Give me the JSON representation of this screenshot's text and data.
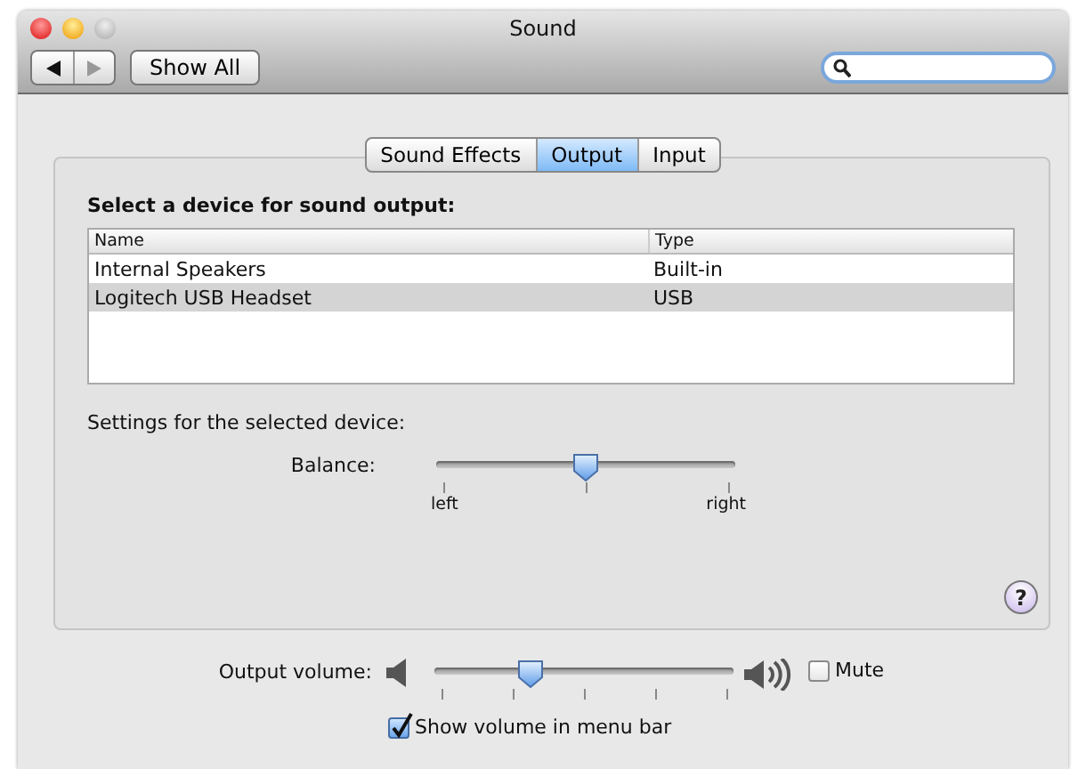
{
  "window": {
    "title": "Sound"
  },
  "toolbar": {
    "show_all": "Show All"
  },
  "tabs": [
    {
      "label": "Sound Effects",
      "selected": false
    },
    {
      "label": "Output",
      "selected": true
    },
    {
      "label": "Input",
      "selected": false
    }
  ],
  "devices": {
    "heading": "Select a device for sound output:",
    "columns": [
      "Name",
      "Type"
    ],
    "rows": [
      {
        "name": "Internal Speakers",
        "type": "Built-in",
        "selected": false
      },
      {
        "name": "Logitech USB Headset",
        "type": "USB",
        "selected": true
      }
    ]
  },
  "settings_label": "Settings for the selected device:",
  "balance": {
    "label": "Balance:",
    "level": 0.5,
    "min_label": "left",
    "max_label": "right"
  },
  "help": "?",
  "output_volume": {
    "label": "Output volume:",
    "level": 0.31
  },
  "mute": {
    "label": "Mute",
    "checked": false
  },
  "show_volume": {
    "label": "Show volume in menu bar",
    "checked": true
  }
}
